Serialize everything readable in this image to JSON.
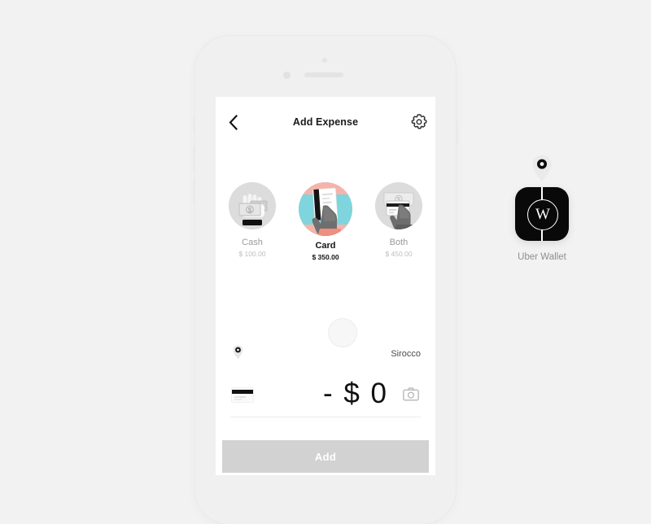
{
  "background_color": "#f2f2f2",
  "phone": {
    "frame_color": "#f0f0f0",
    "screen_color": "#ffffff"
  },
  "screen": {
    "nav": {
      "back_icon": "chevron-left-icon",
      "title": "Add Expense",
      "settings_icon": "gear-icon"
    },
    "payment_options": [
      {
        "id": "cash",
        "label": "Cash",
        "amount": "$ 100.00",
        "selected": false,
        "icon": "cash-in-hand-icon",
        "thumb_color": "#dcdcdc"
      },
      {
        "id": "card",
        "label": "Card",
        "amount": "$ 350.00",
        "selected": true,
        "icon": "card-in-hand-icon",
        "thumb_color": "#f6b3ac"
      },
      {
        "id": "both",
        "label": "Both",
        "amount": "$ 450.00",
        "selected": false,
        "icon": "card-and-cash-icon",
        "thumb_color": "#dcdcdc"
      }
    ],
    "entry": {
      "avatar_placeholder": "avatar-placeholder",
      "location_icon": "location-pin-icon",
      "place_name": "Sirocco",
      "payment_method_icon": "credit-card-icon",
      "amount": "- $ 0",
      "attach_icon": "camera-icon"
    },
    "submit": {
      "label": "Add",
      "color": "#d2d2d2",
      "text_color": "#ffffff"
    }
  },
  "app_shortcut": {
    "pin_icon": "location-pin-icon",
    "icon_letter": "W",
    "icon_background": "#090909",
    "label": "Uber Wallet"
  },
  "accent_colors": {
    "pink": "#f6b3ac",
    "teal": "#7ed5dd",
    "gray": "#dcdcdc",
    "dark": "#141414"
  }
}
